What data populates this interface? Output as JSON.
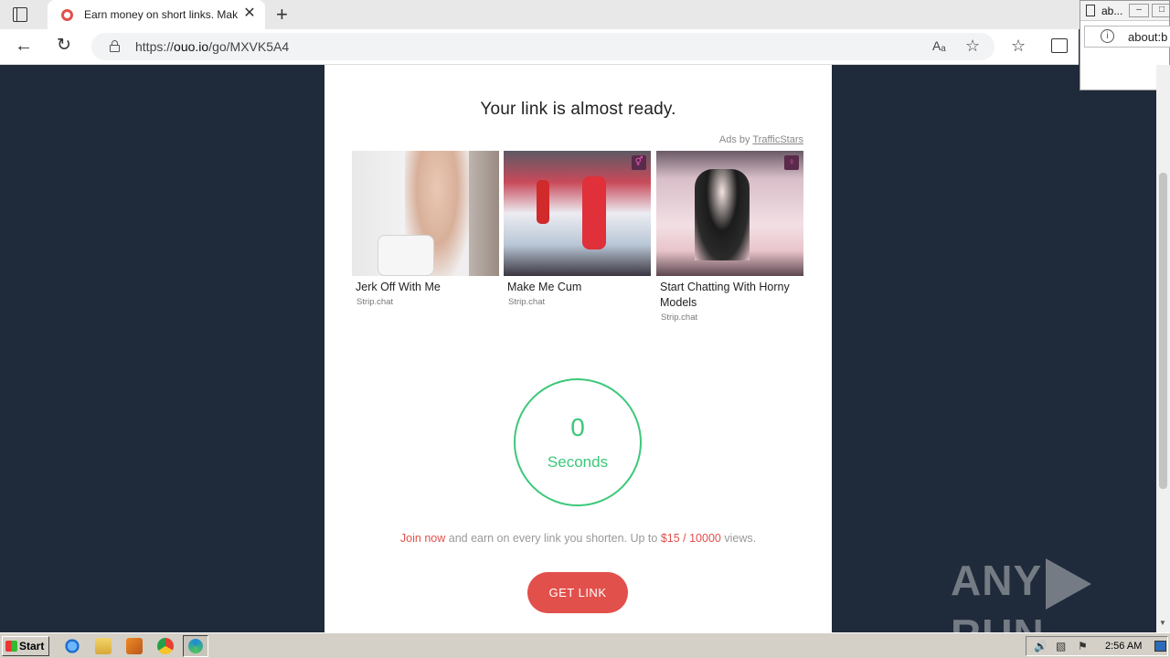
{
  "browser": {
    "tab_title": "Earn money on short links. Mak",
    "tab_close": "✕",
    "new_tab": "+",
    "url_prefix": "https://",
    "url_host": "ouo.io",
    "url_path": "/go/MXVK5A4"
  },
  "popup": {
    "title": "ab...",
    "url": "about:b"
  },
  "page": {
    "title": "Your link is almost ready.",
    "ads_by_prefix": "Ads by ",
    "ads_by_brand": "TrafficStars",
    "ads": [
      {
        "caption": "Jerk Off With Me",
        "source": "Strip.chat"
      },
      {
        "caption": "Make Me Cum",
        "source": "Strip.chat"
      },
      {
        "caption": "Start Chatting With Horny Models",
        "source": "Strip.chat"
      }
    ],
    "timer_value": "0",
    "timer_label": "Seconds",
    "promo_join": "Join now",
    "promo_middle": " and earn on every link you shorten. Up to ",
    "promo_amount": "$15 / 10000",
    "promo_end": " views.",
    "get_link_label": "GET LINK"
  },
  "watermark": {
    "left": "ANY",
    "right": "RUN"
  },
  "taskbar": {
    "start_label": "Start",
    "time": "2:56 AM"
  },
  "colors": {
    "accent_red": "#e2504c",
    "timer_green": "#3cc87a",
    "background_navy": "#1f2a3a"
  }
}
